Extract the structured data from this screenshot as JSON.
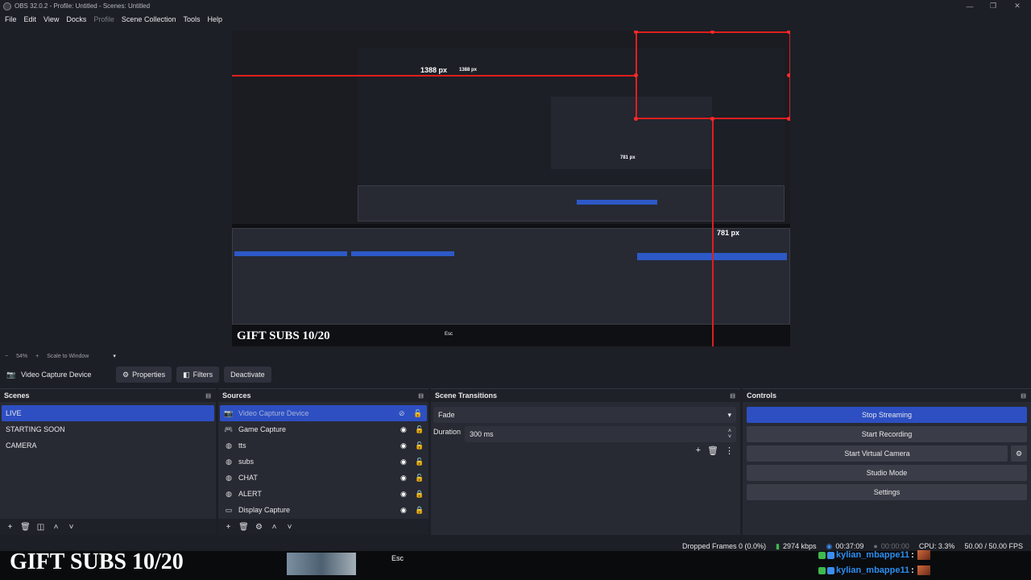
{
  "window": {
    "title": "OBS 32.0.2 - Profile: Untitled - Scenes: Untitled",
    "minimize": "—",
    "maximize": "❐",
    "close": "✕"
  },
  "menu": [
    "File",
    "Edit",
    "View",
    "Docks",
    "Profile",
    "Scene Collection",
    "Tools",
    "Help"
  ],
  "preview": {
    "measure_width": "1388 px",
    "measure_width_nested": "1388 px",
    "measure_height": "781 px",
    "measure_height_nested": "781 px",
    "overlay_text": "GIFT SUBS 10/20",
    "esc_label": "Esc"
  },
  "zoom": {
    "minus": "−",
    "level": "54%",
    "plus": "+",
    "mode": "Scale to Window"
  },
  "source_toolbar": {
    "selected_source": "Video Capture Device",
    "properties": "Properties",
    "filters": "Filters",
    "deactivate": "Deactivate"
  },
  "scenes": {
    "title": "Scenes",
    "items": [
      "LIVE",
      "STARTING SOON",
      "CAMERA"
    ],
    "selected_index": 0
  },
  "sources": {
    "title": "Sources",
    "items": [
      {
        "name": "Video Capture Device",
        "icon": "camera-icon",
        "visible": false,
        "locked": false
      },
      {
        "name": "Game Capture",
        "icon": "gamepad-icon",
        "visible": true,
        "locked": false
      },
      {
        "name": "tts",
        "icon": "globe-icon",
        "visible": true,
        "locked": false
      },
      {
        "name": "subs",
        "icon": "globe-icon",
        "visible": true,
        "locked": false
      },
      {
        "name": "CHAT",
        "icon": "globe-icon",
        "visible": true,
        "locked": false
      },
      {
        "name": "ALERT",
        "icon": "globe-icon",
        "visible": true,
        "locked": true
      },
      {
        "name": "Display Capture",
        "icon": "monitor-icon",
        "visible": true,
        "locked": true
      }
    ]
  },
  "transitions": {
    "title": "Scene Transitions",
    "selected": "Fade",
    "duration_label": "Duration",
    "duration_value": "300 ms"
  },
  "controls": {
    "title": "Controls",
    "stop_streaming": "Stop Streaming",
    "start_recording": "Start Recording",
    "start_virtual_camera": "Start Virtual Camera",
    "studio_mode": "Studio Mode",
    "settings": "Settings"
  },
  "status": {
    "dropped_frames": "Dropped Frames 0 (0.0%)",
    "bitrate": "2974 kbps",
    "stream_time": "00:37:09",
    "rec_time": "00:00:00",
    "cpu": "CPU: 3.3%",
    "fps": "50.00 / 50.00 FPS"
  },
  "chat": {
    "lines": [
      "kylian_mbappe11",
      "kylian_mbappe11"
    ],
    "colon": ":"
  },
  "colors": {
    "accent": "#2d4fc2",
    "measure_red": "#e01e1e",
    "chat_name": "#2c8ef0"
  }
}
